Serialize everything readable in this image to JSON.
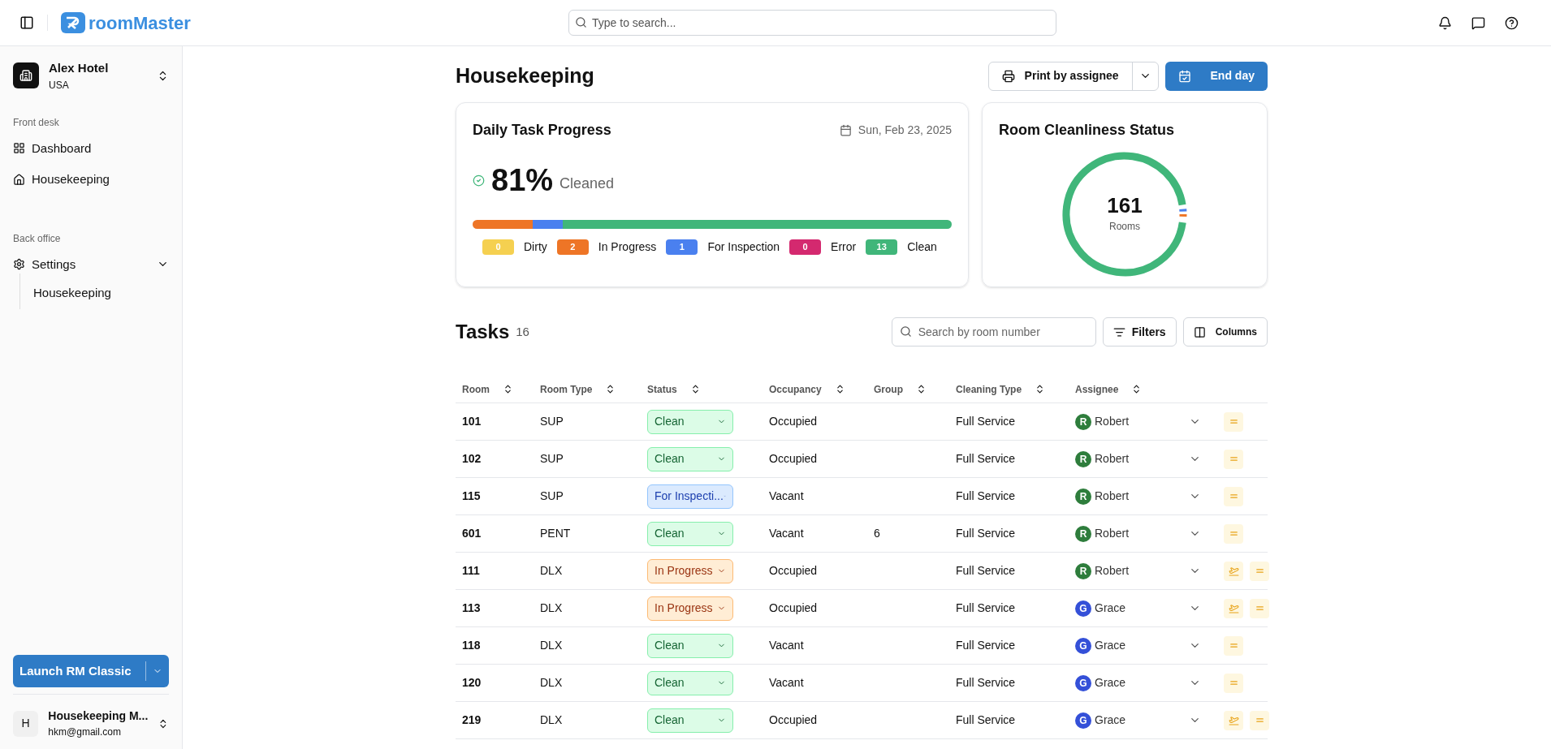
{
  "topbar": {
    "logo": "roomMaster",
    "search": {
      "placeholder": "Type to search..."
    }
  },
  "sidebar": {
    "property": {
      "name": "Alex Hotel",
      "country": "USA"
    },
    "sections": [
      {
        "title": "Front desk",
        "items": [
          {
            "label": "Dashboard"
          },
          {
            "label": "Housekeeping"
          }
        ]
      },
      {
        "title": "Back office",
        "items": [
          {
            "label": "Settings",
            "expanded": true,
            "children": [
              {
                "label": "Housekeeping"
              }
            ]
          }
        ]
      }
    ],
    "launch_button": "Launch RM Classic",
    "user": {
      "initial": "H",
      "name": "Housekeeping M...",
      "email": "hkm@gmail.com"
    }
  },
  "page": {
    "title": "Housekeeping",
    "print_button": "Print by assignee",
    "end_day_button": "End day"
  },
  "progress_card": {
    "title": "Daily Task Progress",
    "date": "Sun, Feb 23, 2025",
    "percent": "81%",
    "percent_label": "Cleaned",
    "legend": [
      {
        "count": "0",
        "label": "Dirty",
        "color": "#f5d050"
      },
      {
        "count": "2",
        "label": "In Progress",
        "color": "#ee7526"
      },
      {
        "count": "1",
        "label": "For Inspection",
        "color": "#4a80ef"
      },
      {
        "count": "0",
        "label": "Error",
        "color": "#d4296f"
      },
      {
        "count": "13",
        "label": "Clean",
        "color": "#40b67a"
      }
    ]
  },
  "status_card": {
    "title": "Room Cleanliness Status",
    "total": "161",
    "total_label": "Rooms"
  },
  "tasks": {
    "title": "Tasks",
    "count": "16",
    "search": {
      "placeholder": "Search by room number"
    },
    "filters_button": "Filters",
    "columns_button": "Columns",
    "columns": [
      "Room",
      "Room Type",
      "Status",
      "Occupancy",
      "Group",
      "Cleaning Type",
      "Assignee"
    ],
    "rows": [
      {
        "room": "101",
        "room_type": "SUP",
        "status": {
          "text": "Clean",
          "kind": "clean"
        },
        "occupancy": "Occupied",
        "group": "",
        "cleaning_type": "Full Service",
        "assignee": {
          "initial": "R",
          "name": "Robert",
          "color": "#2e7d3c"
        },
        "extra_action": false
      },
      {
        "room": "102",
        "room_type": "SUP",
        "status": {
          "text": "Clean",
          "kind": "clean"
        },
        "occupancy": "Occupied",
        "group": "",
        "cleaning_type": "Full Service",
        "assignee": {
          "initial": "R",
          "name": "Robert",
          "color": "#2e7d3c"
        },
        "extra_action": false
      },
      {
        "room": "115",
        "room_type": "SUP",
        "status": {
          "text": "For Inspecti...",
          "kind": "inspection"
        },
        "occupancy": "Vacant",
        "group": "",
        "cleaning_type": "Full Service",
        "assignee": {
          "initial": "R",
          "name": "Robert",
          "color": "#2e7d3c"
        },
        "extra_action": false
      },
      {
        "room": "601",
        "room_type": "PENT",
        "status": {
          "text": "Clean",
          "kind": "clean"
        },
        "occupancy": "Vacant",
        "group": "6",
        "cleaning_type": "Full Service",
        "assignee": {
          "initial": "R",
          "name": "Robert",
          "color": "#2e7d3c"
        },
        "extra_action": false
      },
      {
        "room": "111",
        "room_type": "DLX",
        "status": {
          "text": "In Progress",
          "kind": "progress"
        },
        "occupancy": "Occupied",
        "group": "",
        "cleaning_type": "Full Service",
        "assignee": {
          "initial": "R",
          "name": "Robert",
          "color": "#2e7d3c"
        },
        "extra_action": true
      },
      {
        "room": "113",
        "room_type": "DLX",
        "status": {
          "text": "In Progress",
          "kind": "progress"
        },
        "occupancy": "Occupied",
        "group": "",
        "cleaning_type": "Full Service",
        "assignee": {
          "initial": "G",
          "name": "Grace",
          "color": "#3450d8"
        },
        "extra_action": true
      },
      {
        "room": "118",
        "room_type": "DLX",
        "status": {
          "text": "Clean",
          "kind": "clean"
        },
        "occupancy": "Vacant",
        "group": "",
        "cleaning_type": "Full Service",
        "assignee": {
          "initial": "G",
          "name": "Grace",
          "color": "#3450d8"
        },
        "extra_action": false
      },
      {
        "room": "120",
        "room_type": "DLX",
        "status": {
          "text": "Clean",
          "kind": "clean"
        },
        "occupancy": "Vacant",
        "group": "",
        "cleaning_type": "Full Service",
        "assignee": {
          "initial": "G",
          "name": "Grace",
          "color": "#3450d8"
        },
        "extra_action": false
      },
      {
        "room": "219",
        "room_type": "DLX",
        "status": {
          "text": "Clean",
          "kind": "clean"
        },
        "occupancy": "Occupied",
        "group": "",
        "cleaning_type": "Full Service",
        "assignee": {
          "initial": "G",
          "name": "Grace",
          "color": "#3450d8"
        },
        "extra_action": true
      }
    ]
  }
}
